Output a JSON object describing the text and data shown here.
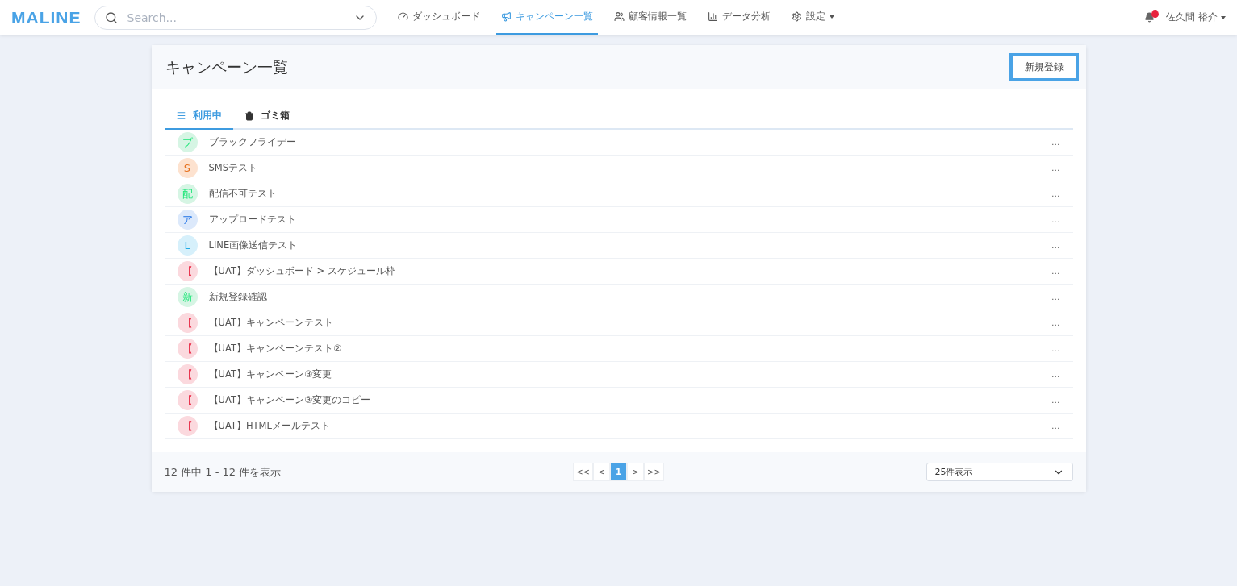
{
  "brand": "MALINE",
  "search": {
    "placeholder": "Search..."
  },
  "nav": [
    {
      "label": "ダッシュボード",
      "kind": "gauge",
      "selected": false,
      "dropdown": false
    },
    {
      "label": "キャンペーン一覧",
      "kind": "megaphone",
      "selected": true,
      "dropdown": false
    },
    {
      "label": "顧客情報一覧",
      "kind": "users",
      "selected": false,
      "dropdown": false
    },
    {
      "label": "データ分析",
      "kind": "chart",
      "selected": false,
      "dropdown": false
    },
    {
      "label": "設定",
      "kind": "gear",
      "selected": false,
      "dropdown": true
    }
  ],
  "user": {
    "name": "佐久間 裕介",
    "notification": true
  },
  "page": {
    "title": "キャンペーン一覧",
    "new_button": "新規登録"
  },
  "tabs": [
    {
      "label": "利用中",
      "kind": "active",
      "selected": true
    },
    {
      "label": "ゴミ箱",
      "kind": "trash",
      "selected": false
    }
  ],
  "campaigns": [
    {
      "avatar": "ブ",
      "name": "ブラックフライデー",
      "color": "#d6f5e4",
      "menu": "..."
    },
    {
      "avatar": "S",
      "name": "SMSテスト",
      "color": "#fde2cf",
      "menu": "..."
    },
    {
      "avatar": "配",
      "name": "配信不可テスト",
      "color": "#d6f5e4",
      "menu": "..."
    },
    {
      "avatar": "ア",
      "name": "アップロードテスト",
      "color": "#dce9fb",
      "menu": "..."
    },
    {
      "avatar": "L",
      "name": "LINE画像送信テスト",
      "color": "#d6f0fb",
      "menu": "..."
    },
    {
      "avatar": "【",
      "name": "【UAT】ダッシュボード > スケジュール枠",
      "color": "#fbd9de",
      "menu": "..."
    },
    {
      "avatar": "新",
      "name": "新規登録確認",
      "color": "#d6f5e4",
      "menu": "..."
    },
    {
      "avatar": "【",
      "name": "【UAT】キャンペーンテスト",
      "color": "#fbd9de",
      "menu": "..."
    },
    {
      "avatar": "【",
      "name": "【UAT】キャンペーンテスト②",
      "color": "#fbd9de",
      "menu": "..."
    },
    {
      "avatar": "【",
      "name": "【UAT】キャンペーン③変更",
      "color": "#fbd9de",
      "menu": "..."
    },
    {
      "avatar": "【",
      "name": "【UAT】キャンペーン③変更のコピー",
      "color": "#fbd9de",
      "menu": "..."
    },
    {
      "avatar": "【",
      "name": "【UAT】HTMLメールテスト",
      "color": "#fbd9de",
      "menu": "..."
    }
  ],
  "footer": {
    "summary": "12 件中 1 - 12 件を表示",
    "pagination": [
      {
        "label": "<<",
        "selected": false
      },
      {
        "label": "<",
        "selected": false
      },
      {
        "label": "1",
        "selected": true
      },
      {
        "label": ">",
        "selected": false
      },
      {
        "label": ">>",
        "selected": false
      }
    ],
    "page_size": "25件表示"
  }
}
